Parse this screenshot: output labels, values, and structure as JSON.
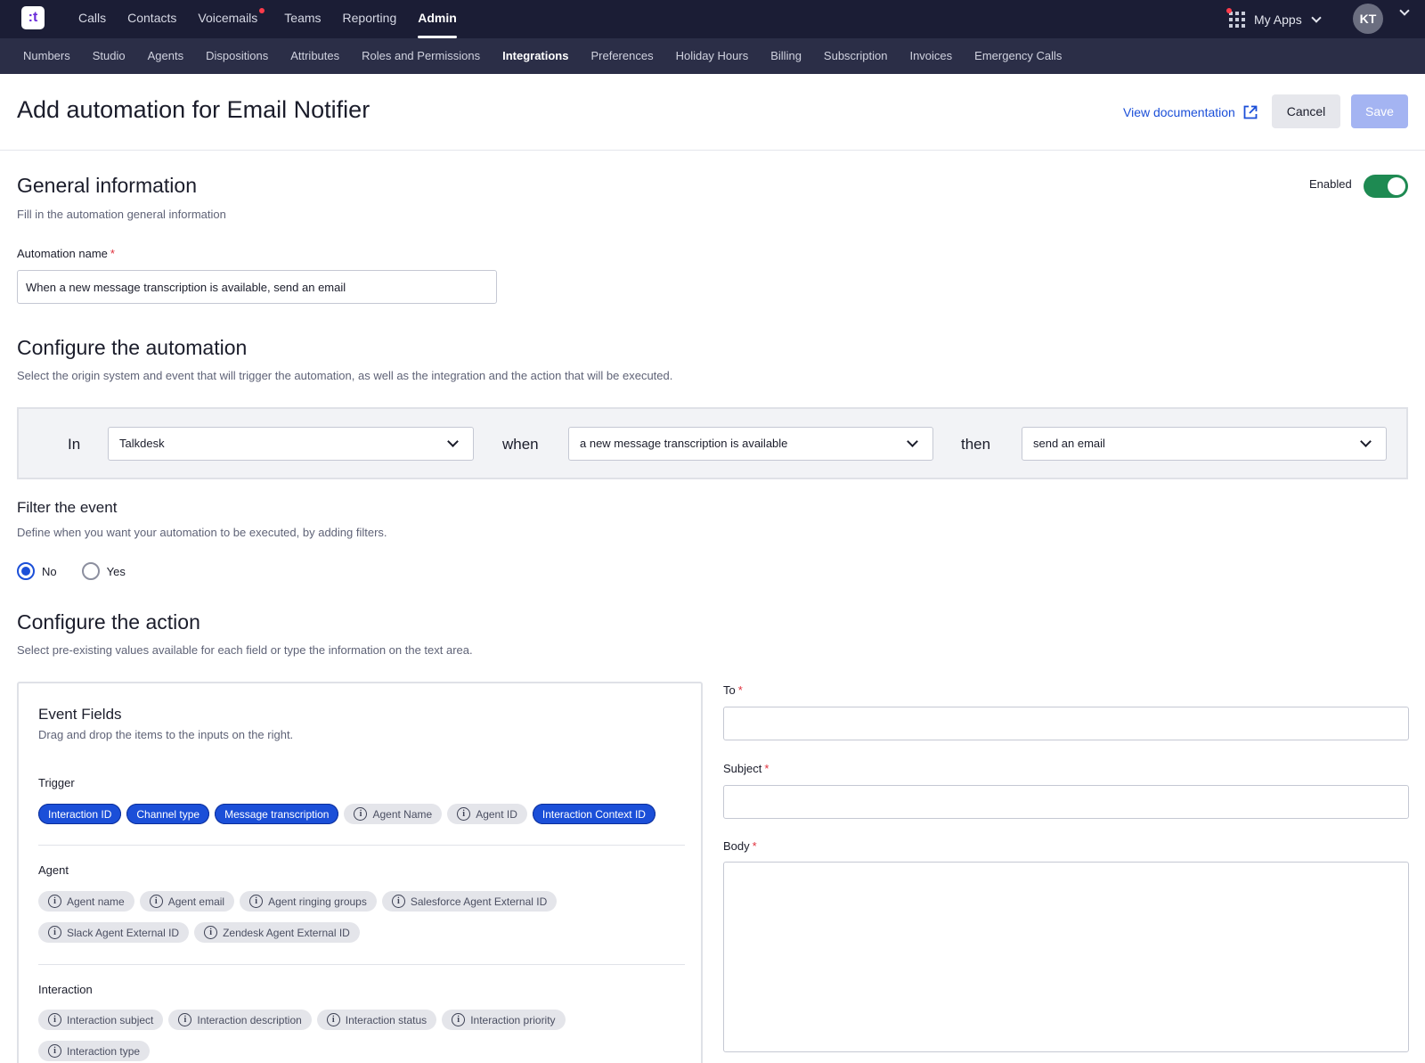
{
  "app": {
    "logo_text": ":t",
    "top_nav": [
      {
        "label": "Calls"
      },
      {
        "label": "Contacts"
      },
      {
        "label": "Voicemails"
      },
      {
        "label": "Teams"
      },
      {
        "label": "Reporting"
      },
      {
        "label": "Admin"
      }
    ],
    "my_apps_label": "My Apps",
    "avatar_initials": "KT",
    "sub_nav": [
      {
        "label": "Numbers"
      },
      {
        "label": "Studio"
      },
      {
        "label": "Agents"
      },
      {
        "label": "Dispositions"
      },
      {
        "label": "Attributes"
      },
      {
        "label": "Roles and Permissions"
      },
      {
        "label": "Integrations"
      },
      {
        "label": "Preferences"
      },
      {
        "label": "Holiday Hours"
      },
      {
        "label": "Billing"
      },
      {
        "label": "Subscription"
      },
      {
        "label": "Invoices"
      },
      {
        "label": "Emergency Calls"
      }
    ],
    "colors": {
      "topbar": "#1b1d35",
      "subbar": "#2b2e47",
      "primary": "#1b4fd8",
      "toggle_on": "#1e8a52",
      "save_disabled": "#a4b4f2"
    }
  },
  "header": {
    "title": "Add automation for Email Notifier",
    "doc_link": "View documentation",
    "cancel_label": "Cancel",
    "save_label": "Save"
  },
  "general": {
    "title": "General information",
    "description": "Fill in the automation general information",
    "enabled_label": "Enabled",
    "enabled": true,
    "name_label": "Automation name",
    "required_mark": "*",
    "name_value": "When a new message transcription is available, send an email"
  },
  "configure": {
    "title": "Configure the automation",
    "description": "Select the origin system and event that will trigger the automation, as well as the integration and the action that will be executed.",
    "in_label": "In",
    "when_label": "when",
    "then_label": "then",
    "origin_value": "Talkdesk",
    "event_value": "a new message transcription is available",
    "action_value": "send an email"
  },
  "filter": {
    "title": "Filter the event",
    "description": "Define when you want your automation to be executed, by adding filters.",
    "option_no": "No",
    "option_yes": "Yes",
    "selected": "No"
  },
  "action": {
    "title": "Configure the action",
    "description": "Select pre-existing values available for each field or type the information on the text area.",
    "to_label": "To",
    "subject_label": "Subject",
    "body_label": "Body"
  },
  "event_fields": {
    "title": "Event Fields",
    "description": "Drag and drop the items to the inputs on the right.",
    "groups": [
      {
        "label": "Trigger",
        "rows": [
          [
            {
              "label": "Interaction ID",
              "active": true
            },
            {
              "label": "Channel type",
              "active": true
            },
            {
              "label": "Message transcription",
              "active": true
            },
            {
              "label": "Agent Name",
              "active": false
            },
            {
              "label": "Agent ID",
              "active": false
            },
            {
              "label": "Interaction Context ID",
              "active": true
            }
          ]
        ]
      },
      {
        "label": "Agent",
        "rows": [
          [
            {
              "label": "Agent name",
              "active": false
            },
            {
              "label": "Agent email",
              "active": false
            },
            {
              "label": "Agent ringing groups",
              "active": false
            },
            {
              "label": "Salesforce Agent External ID",
              "active": false
            }
          ],
          [
            {
              "label": "Slack Agent External ID",
              "active": false
            },
            {
              "label": "Zendesk Agent External ID",
              "active": false
            }
          ]
        ]
      },
      {
        "label": "Interaction",
        "rows": [
          [
            {
              "label": "Interaction subject",
              "active": false
            },
            {
              "label": "Interaction description",
              "active": false
            },
            {
              "label": "Interaction status",
              "active": false
            },
            {
              "label": "Interaction priority",
              "active": false
            }
          ],
          [
            {
              "label": "Interaction type",
              "active": false
            }
          ]
        ]
      }
    ]
  }
}
